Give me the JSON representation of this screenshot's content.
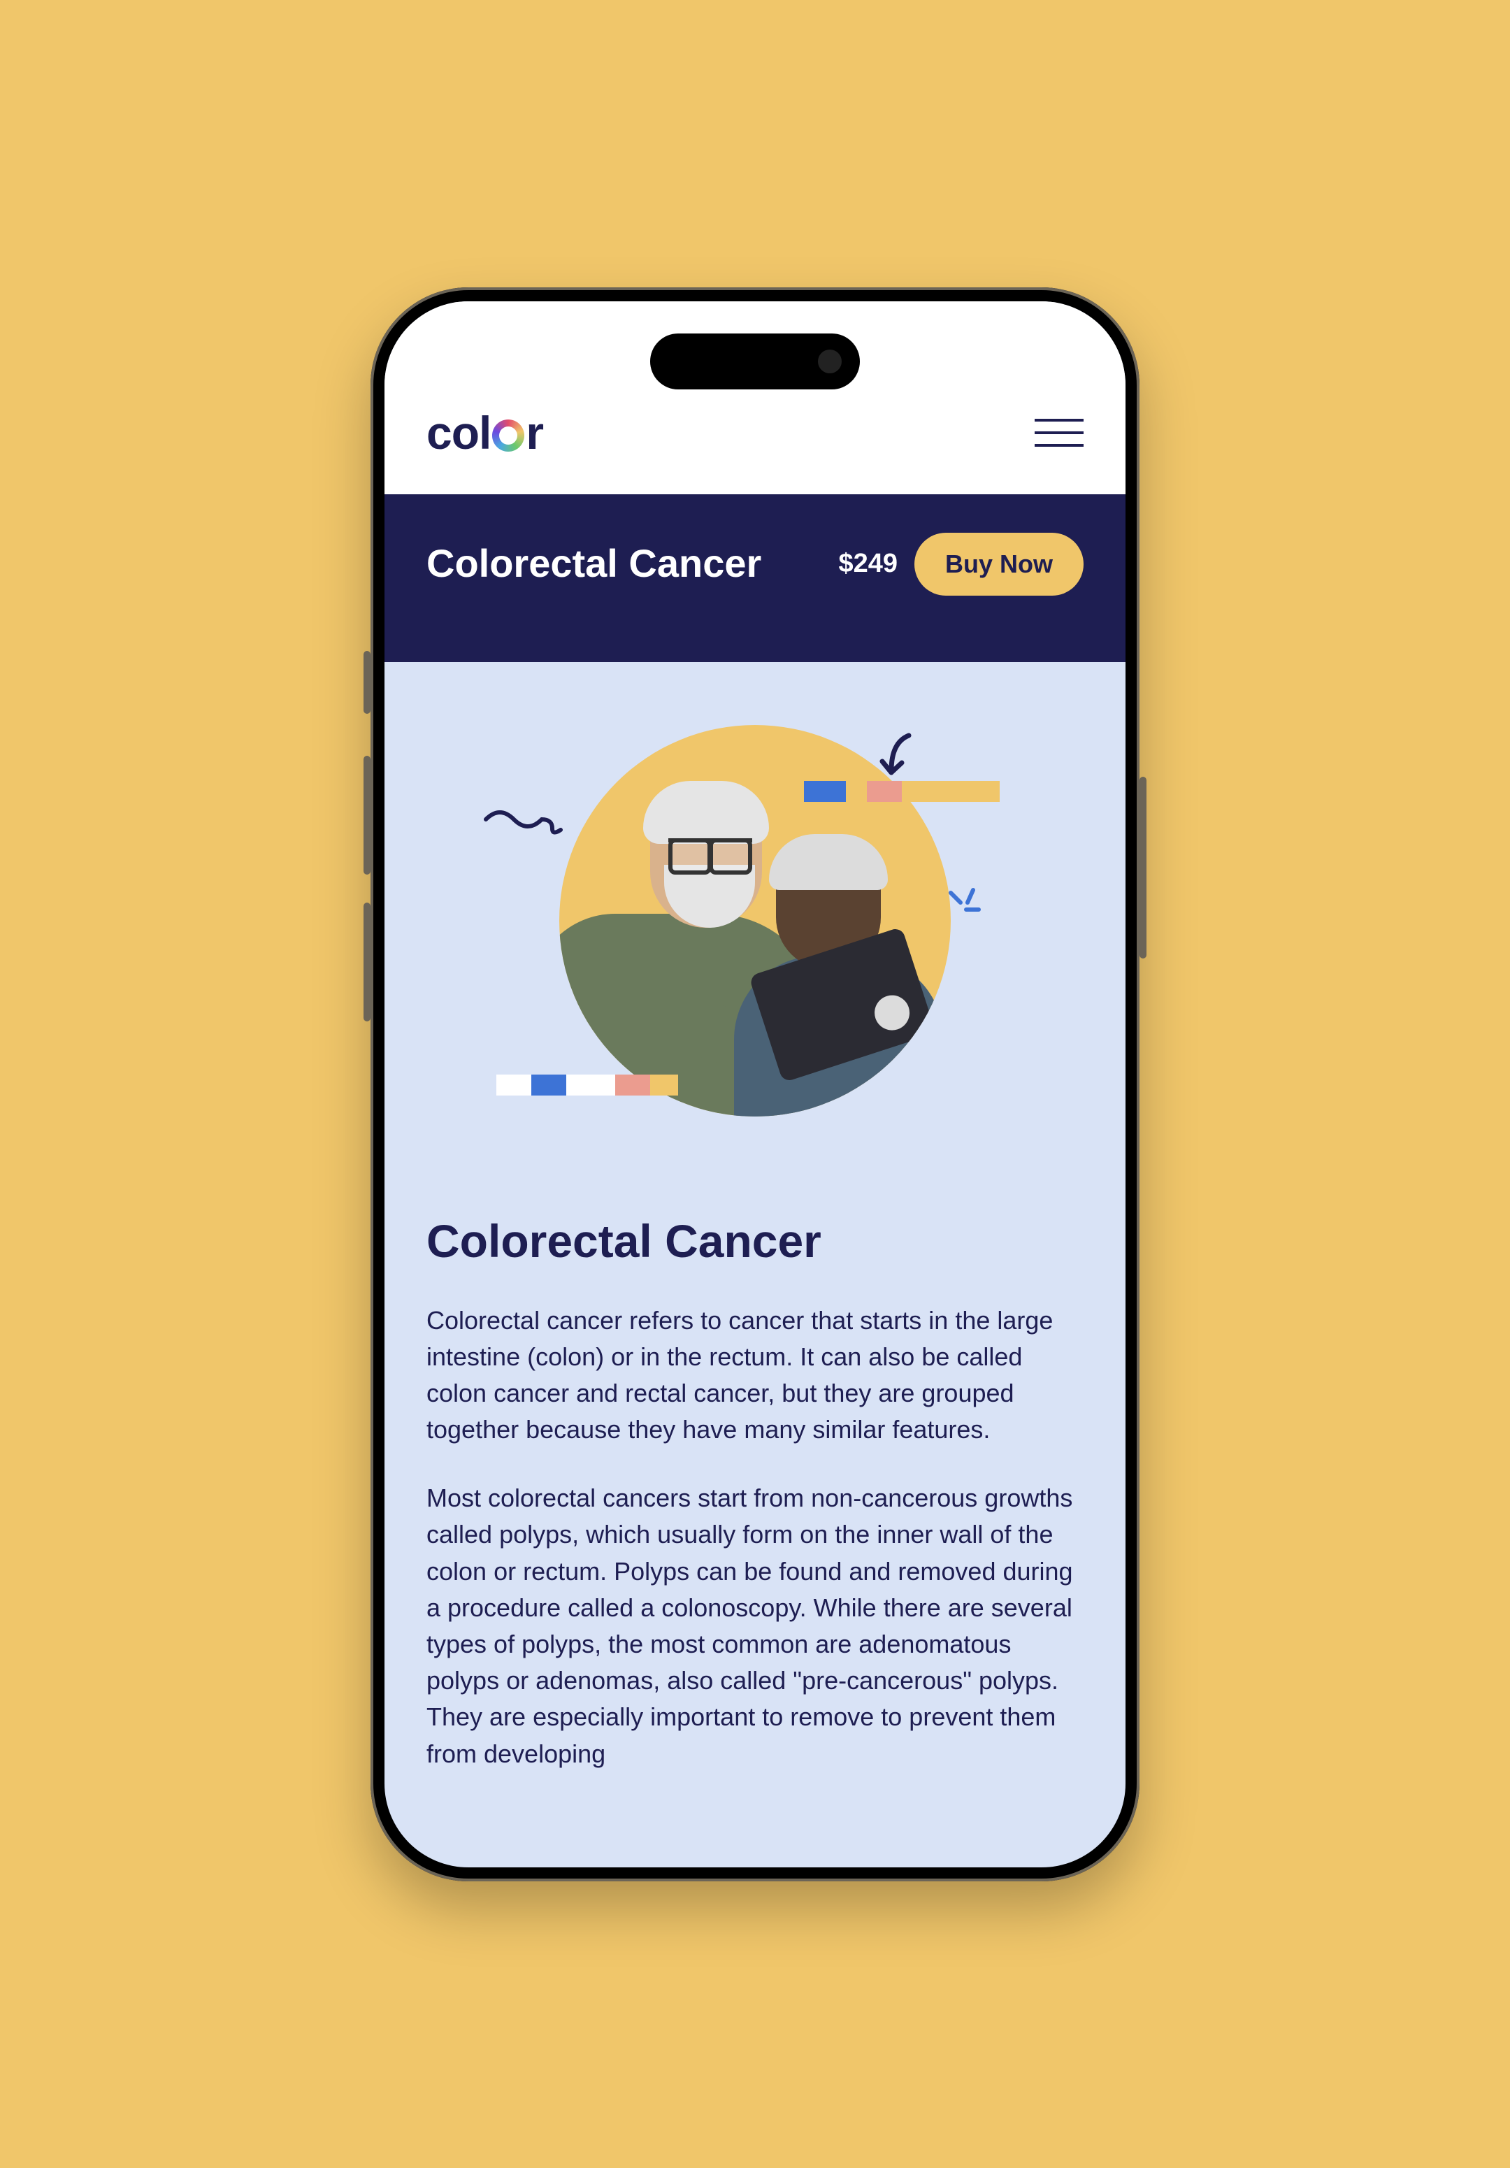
{
  "header": {
    "logo_prefix": "col",
    "logo_suffix": "r"
  },
  "subheader": {
    "title": "Colorectal Cancer",
    "price": "$249",
    "buy_label": "Buy Now"
  },
  "main": {
    "title": "Colorectal Cancer",
    "paragraphs": [
      "Colorectal cancer refers to cancer that starts in the large intestine (colon) or in the rectum. It can also be called colon cancer and rectal cancer, but they are grouped together because they have many similar features.",
      "Most colorectal cancers start from non-cancerous growths called polyps, which usually form on the inner wall of the colon or rectum. Polyps can be found and removed during a procedure called a colonoscopy. While there are several types of polyps, the most common are adenomatous polyps or adenomas, also called \"pre-cancerous\" polyps. They are especially important to remove to prevent them from developing"
    ]
  },
  "colors": {
    "accent_yellow": "#f0c66a",
    "navy": "#1e1e52",
    "content_bg": "#d9e3f6"
  }
}
